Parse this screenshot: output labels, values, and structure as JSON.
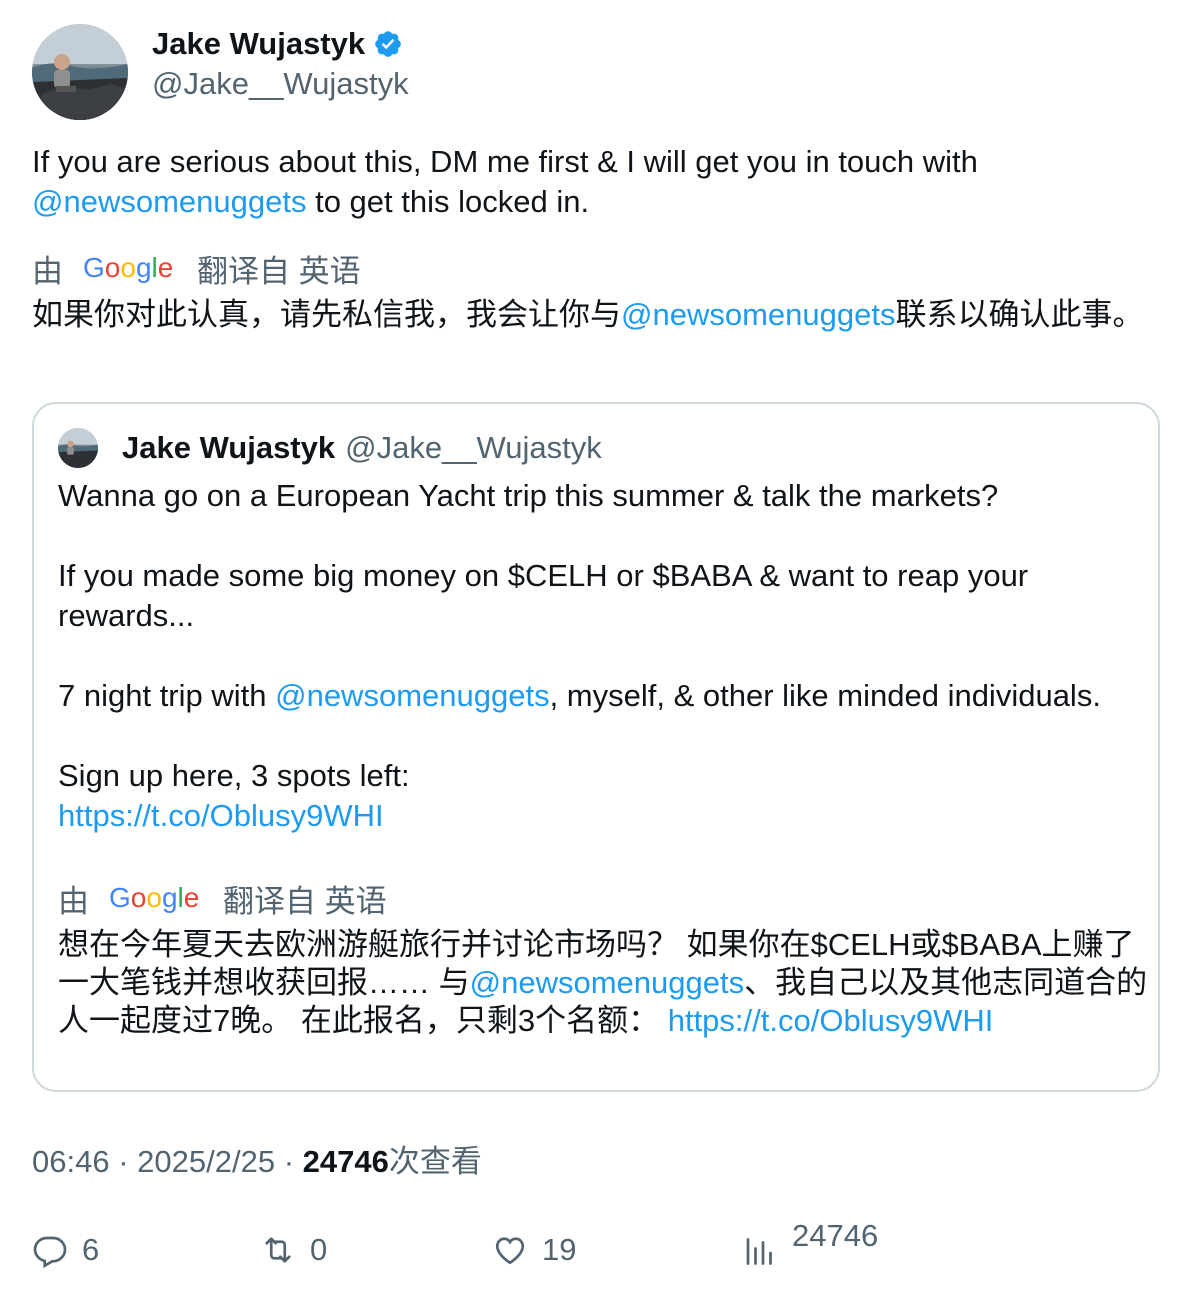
{
  "author": {
    "display_name": "Jake Wujastyk",
    "handle": "@Jake__Wujastyk",
    "verified": true
  },
  "tweet": {
    "text_before": "If you are serious about this, DM me first & I will get you in touch with",
    "mention": "@newsomenuggets",
    "text_after": " to get this locked in.",
    "translate_prefix": "由",
    "translate_suffix": "翻译自 英语",
    "translation_before": "如果你对此认真，请先私信我，我会让你与",
    "translation_mention": "@newsomenuggets",
    "translation_after": "联系以确认此事。"
  },
  "quoted": {
    "display_name": "Jake Wujastyk",
    "handle": "@Jake__Wujastyk",
    "line1": "Wanna go on a European Yacht trip this summer & talk the markets?",
    "line2": "If you made some big money on $CELH or $BABA & want to reap your rewards...",
    "line3_before": "7 night trip with ",
    "line3_mention": "@newsomenuggets",
    "line3_after": ", myself, & other like minded individuals.",
    "line4": "Sign up here, 3 spots left:",
    "link": "https://t.co/Oblusy9WHI",
    "translate_prefix": "由",
    "translate_suffix": "翻译自 英语",
    "translation_1": "想在今年夏天去欧洲游艇旅行并讨论市场吗？ 如果你在$CELH或$BABA上赚了一大笔钱并想收获回报…… 与",
    "translation_mention": "@newsomenuggets",
    "translation_2": "、我自己以及其他志同道合的人一起度过7晚。 在此报名，只剩3个名额：",
    "translation_link": "https://t.co/Oblusy9WHI"
  },
  "meta": {
    "time": "06:46",
    "date": "2025/2/25",
    "views": "24746",
    "views_label": "次查看",
    "separator": "·"
  },
  "actions": {
    "replies": "6",
    "retweets": "0",
    "likes": "19",
    "views": "24746"
  },
  "colors": {
    "link": "#1d9bf0",
    "secondary_text": "#536471",
    "border": "#cfd9de"
  }
}
